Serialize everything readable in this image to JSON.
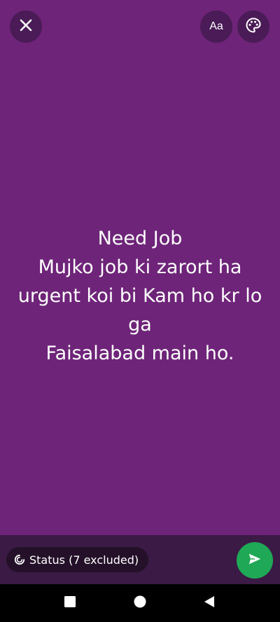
{
  "header": {
    "close_icon": "close-icon",
    "font_button_label": "Aa",
    "palette_icon": "palette-icon"
  },
  "status": {
    "text": "Need Job\nMujko job ki zarort ha\nurgent koi bi Kam ho kr lo\nga\nFaisalabad main ho.",
    "background_color": "#6e2479"
  },
  "footer": {
    "audience_label": "Status (7 excluded)",
    "audience_icon": "status-ring-icon",
    "send_icon": "send-icon",
    "send_color": "#1fa855"
  },
  "navigation": {
    "recents_icon": "square-icon",
    "home_icon": "circle-icon",
    "back_icon": "triangle-back-icon"
  }
}
